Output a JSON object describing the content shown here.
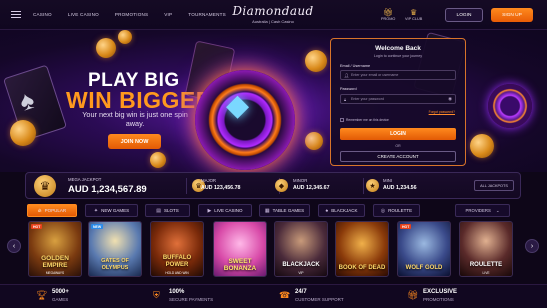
{
  "nav": {
    "links": [
      "CASINO",
      "LIVE CASINO",
      "PROMOTIONS",
      "VIP",
      "TOURNAMENTS"
    ],
    "logo_text": "Diamondaud",
    "logo_sub": "Australia | Cash Casino",
    "promo_label": "PROMO",
    "vip_label": "VIP CLUB",
    "login_label": "LOGIN",
    "signup_label": "SIGN UP"
  },
  "hero": {
    "line1": "PLAY BIG",
    "line2": "WIN BIGGER",
    "subtitle": "Your next big win is just one spin away.",
    "cta": "JOIN NOW"
  },
  "login": {
    "title": "Welcome Back",
    "subtitle": "Login to continue your journey",
    "email_label": "Email / Username",
    "email_placeholder": "Enter your email or username",
    "password_label": "Password",
    "password_placeholder": "Enter your password",
    "remember": "Remember me on this device",
    "forgot": "Forgot password?",
    "login_button": "LOGIN",
    "or": "OR",
    "create_button": "CREATE ACCOUNT"
  },
  "jackpots": {
    "mega_label": "MEGA JACKPOT",
    "mega_value": "AUD 1,234,567.89",
    "major_label": "MAJOR",
    "major_value": "AUD 123,456.78",
    "minor_label": "MINOR",
    "minor_value": "AUD 12,345.67",
    "mini_label": "MINI",
    "mini_value": "AUD 1,234.56",
    "all_button": "ALL JACKPOTS"
  },
  "tabs": [
    "POPULAR",
    "NEW GAMES",
    "SLOTS",
    "LIVE CASINO",
    "TABLE GAMES",
    "BLACKJACK",
    "ROULETTE"
  ],
  "providers_label": "PROVIDERS",
  "games": [
    {
      "title": "GOLDEN EMPIRE",
      "sub": "MEGAWAYS",
      "badge": "HOT"
    },
    {
      "title": "GATES OF OLYMPUS",
      "sub": "",
      "badge": "NEW"
    },
    {
      "title": "BUFFALO POWER",
      "sub": "HOLD AND WIN",
      "badge": ""
    },
    {
      "title": "SWEET BONANZA",
      "sub": "",
      "badge": ""
    },
    {
      "title": "BLACKJACK",
      "sub": "VIP",
      "badge": ""
    },
    {
      "title": "BOOK OF DEAD",
      "sub": "",
      "badge": ""
    },
    {
      "title": "WOLF GOLD",
      "sub": "",
      "badge": "HOT"
    },
    {
      "title": "ROULETTE",
      "sub": "LIVE",
      "badge": ""
    }
  ],
  "footer": [
    {
      "value": "5000+",
      "label": "GAMES",
      "icon": "trophy-icon"
    },
    {
      "value": "100%",
      "label": "SECURE PAYMENTS",
      "icon": "shield-icon"
    },
    {
      "value": "24/7",
      "label": "CUSTOMER SUPPORT",
      "icon": "headset-icon"
    },
    {
      "value": "EXCLUSIVE",
      "label": "PROMOTIONS",
      "icon": "gift-icon"
    }
  ],
  "colors": {
    "accent": "#ff8a1e",
    "background": "#0e0618",
    "panel_border": "#d8742a"
  }
}
